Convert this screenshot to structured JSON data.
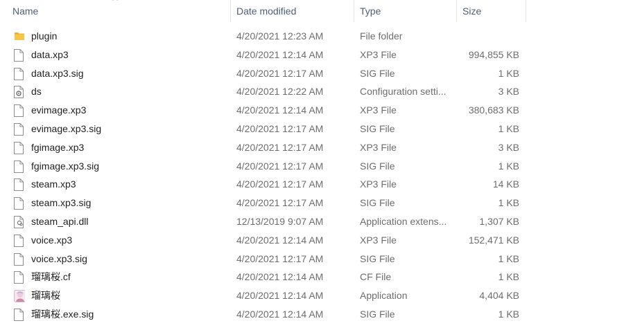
{
  "columns": {
    "name": "Name",
    "date_modified": "Date modified",
    "type": "Type",
    "size": "Size"
  },
  "colors": {
    "folder": "#f8c546",
    "header_text": "#4c607a",
    "meta_text": "#6d6d6d"
  },
  "files": [
    {
      "name": "plugin",
      "date": "4/20/2021 12:23 AM",
      "type": "File folder",
      "size": "",
      "icon": "folder-icon"
    },
    {
      "name": "data.xp3",
      "date": "4/20/2021 12:14 AM",
      "type": "XP3 File",
      "size": "994,855 KB",
      "icon": "file-icon"
    },
    {
      "name": "data.xp3.sig",
      "date": "4/20/2021 12:17 AM",
      "type": "SIG File",
      "size": "1 KB",
      "icon": "file-icon"
    },
    {
      "name": "ds",
      "date": "4/20/2021 12:22 AM",
      "type": "Configuration setti...",
      "size": "3 KB",
      "icon": "config-file-icon"
    },
    {
      "name": "evimage.xp3",
      "date": "4/20/2021 12:14 AM",
      "type": "XP3 File",
      "size": "380,683 KB",
      "icon": "file-icon"
    },
    {
      "name": "evimage.xp3.sig",
      "date": "4/20/2021 12:17 AM",
      "type": "SIG File",
      "size": "1 KB",
      "icon": "file-icon"
    },
    {
      "name": "fgimage.xp3",
      "date": "4/20/2021 12:17 AM",
      "type": "XP3 File",
      "size": "3 KB",
      "icon": "file-icon"
    },
    {
      "name": "fgimage.xp3.sig",
      "date": "4/20/2021 12:17 AM",
      "type": "SIG File",
      "size": "1 KB",
      "icon": "file-icon"
    },
    {
      "name": "steam.xp3",
      "date": "4/20/2021 12:17 AM",
      "type": "XP3 File",
      "size": "14 KB",
      "icon": "file-icon"
    },
    {
      "name": "steam.xp3.sig",
      "date": "4/20/2021 12:17 AM",
      "type": "SIG File",
      "size": "1 KB",
      "icon": "file-icon"
    },
    {
      "name": "steam_api.dll",
      "date": "12/13/2019 9:07 AM",
      "type": "Application extens...",
      "size": "1,307 KB",
      "icon": "dll-file-icon"
    },
    {
      "name": "voice.xp3",
      "date": "4/20/2021 12:14 AM",
      "type": "XP3 File",
      "size": "152,471 KB",
      "icon": "file-icon"
    },
    {
      "name": "voice.xp3.sig",
      "date": "4/20/2021 12:17 AM",
      "type": "SIG File",
      "size": "1 KB",
      "icon": "file-icon"
    },
    {
      "name": "瑠璃桜.cf",
      "date": "4/20/2021 12:14 AM",
      "type": "CF File",
      "size": "1 KB",
      "icon": "file-icon"
    },
    {
      "name": "瑠璃桜",
      "date": "4/20/2021 12:14 AM",
      "type": "Application",
      "size": "4,404 KB",
      "icon": "app-icon"
    },
    {
      "name": "瑠璃桜.exe.sig",
      "date": "4/20/2021 12:14 AM",
      "type": "SIG File",
      "size": "1 KB",
      "icon": "file-icon"
    }
  ]
}
